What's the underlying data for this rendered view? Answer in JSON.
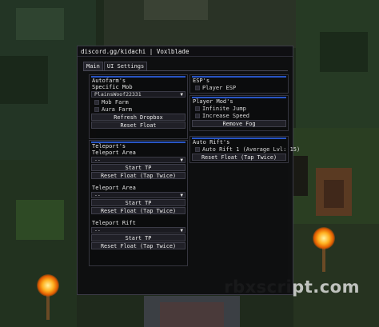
{
  "window": {
    "title": "discord.gg/kidachi | Voxlblade"
  },
  "tabs": [
    "Main",
    "UI Settings"
  ],
  "watermark": "rbxscript.com",
  "autofarm": {
    "header": "Autofarm's",
    "mob_label": "Specific Mob",
    "mob_selected": "PlainsWoof22331",
    "mob_farm": "Mob Farm",
    "aura_farm": "Aura Farm",
    "refresh": "Refresh Dropbox",
    "reset_float": "Reset Float"
  },
  "teleport": {
    "header": "Teleport's",
    "area1_label": "Teleport Area",
    "area1_value": "--",
    "start1": "Start TP",
    "reset1": "Reset Float (Tap Twice)",
    "area2_label": "Teleport Area",
    "area2_value": "--",
    "start2": "Start TP",
    "reset2": "Reset Float (Tap Twice)",
    "rift_label": "Teleport Rift",
    "rift_value": "--",
    "start3": "Start TP",
    "reset3": "Reset Float (Tap Twice)"
  },
  "esp": {
    "header": "ESP's",
    "player_esp": "Player ESP"
  },
  "playermods": {
    "header": "Player Mod's",
    "infinite_jump": "Infinite Jump",
    "increase_speed": "Increase Speed",
    "remove_fog": "Remove Fog"
  },
  "autorift": {
    "header": "Auto Rift's",
    "auto_rift": "Auto Rift 1 (Average Lvl: 15)",
    "reset": "Reset Float (Tap Twice)"
  },
  "colors": {
    "accent": "#2855c4",
    "panel": "#0e0e10",
    "button": "#202027"
  },
  "icons": [
    "chevron-down-icon",
    "checkbox-icon",
    "torch-icon"
  ]
}
